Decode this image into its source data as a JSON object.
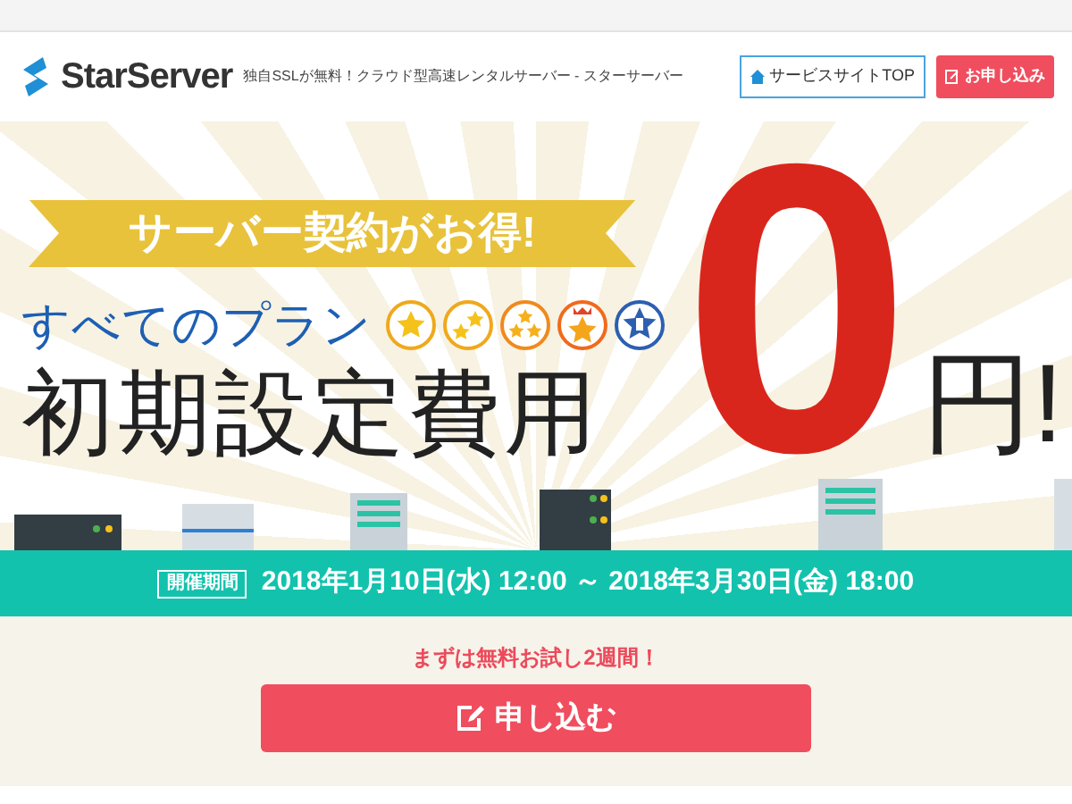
{
  "header": {
    "logo": "StarServer",
    "tagline": "独自SSLが無料！クラウド型高速レンタルサーバー - スターサーバー",
    "buttons": [
      {
        "label": "サービスサイトTOP",
        "kind": "outline"
      },
      {
        "label": "お申し込み",
        "kind": "primary"
      }
    ]
  },
  "hero": {
    "ribbon": "サーバー契約がお得!",
    "plans_label": "すべてのプラン",
    "headline": "初期設定費用",
    "price": "0",
    "unit": "円!"
  },
  "period": {
    "badge": "開催期間",
    "dates": "2018年1月10日(水) 12:00 ～ 2018年3月30日(金) 18:00"
  },
  "cta": {
    "note": "まずは無料お試し2週間！",
    "button": "申し込む"
  }
}
